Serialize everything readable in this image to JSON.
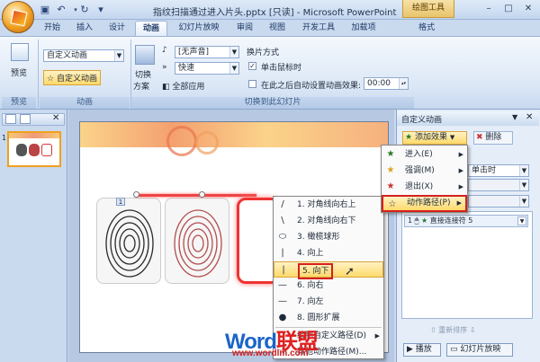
{
  "window": {
    "title": "指纹扫描通过进入片头.pptx [只读] - Microsoft PowerPoint",
    "contextual_tab": "绘图工具",
    "controls": [
      "–",
      "□",
      "✕"
    ]
  },
  "tabs": [
    "开始",
    "插入",
    "设计",
    "动画",
    "幻灯片放映",
    "审阅",
    "视图",
    "开发工具",
    "加载项",
    "格式"
  ],
  "active_tab": "动画",
  "ribbon": {
    "preview": {
      "button": "预览",
      "group": "预览"
    },
    "animation": {
      "custom_combo": "自定义动画",
      "custom_button": "自定义动画",
      "group": "动画"
    },
    "transition": {
      "scheme_label_1": "切换",
      "scheme_label_2": "方案",
      "sound_value": "[无声音]",
      "speed_value": "快速",
      "apply_all": "全部应用",
      "method_title": "换片方式",
      "on_click": "单击鼠标时",
      "after_time": "在此之后自动设置动画效果:",
      "time_value": "00:00",
      "group": "切换到此幻灯片"
    }
  },
  "slides_pane": {
    "slide_number": "1"
  },
  "menu_effects": {
    "items": [
      {
        "icon": "star-green",
        "label": "进入(E)"
      },
      {
        "icon": "star-yellow",
        "label": "强调(M)"
      },
      {
        "icon": "star-red",
        "label": "退出(X)"
      },
      {
        "icon": "star-outline",
        "label": "动作路径(P)"
      }
    ]
  },
  "menu_paths": {
    "items": [
      {
        "icon": "/",
        "label": "1. 对角线向右上"
      },
      {
        "icon": "\\",
        "label": "2. 对角线向右下"
      },
      {
        "icon": "⬭",
        "label": "3. 橄榄球形"
      },
      {
        "icon": "|",
        "label": "4. 向上"
      },
      {
        "icon": "|",
        "label": "5. 向下"
      },
      {
        "icon": "—",
        "label": "6. 向右"
      },
      {
        "icon": "—",
        "label": "7. 向左"
      },
      {
        "icon": "●",
        "label": "8. 圆形扩展"
      },
      {
        "icon": "",
        "label": "绘制自定义路径(D)"
      },
      {
        "icon": "",
        "label": "其他动作路径(M)..."
      }
    ]
  },
  "task_pane": {
    "title": "自定义动画",
    "add_effect": "添加效果",
    "remove": "删除",
    "start_value": "单击时",
    "list_item_number": "1",
    "list_item_label": "直接连接符 5",
    "reorder": "重新排序",
    "play": "播放",
    "slideshow": "幻灯片放映"
  },
  "watermark": {
    "word": "Word",
    "cn": "联盟",
    "url": "www.wordlm.com"
  },
  "colors": {
    "ribbon": "#dbe7f6",
    "highlight": "#ffd96b",
    "red_box": "#d61f1f",
    "watermark_blue": "#1a64c8"
  }
}
